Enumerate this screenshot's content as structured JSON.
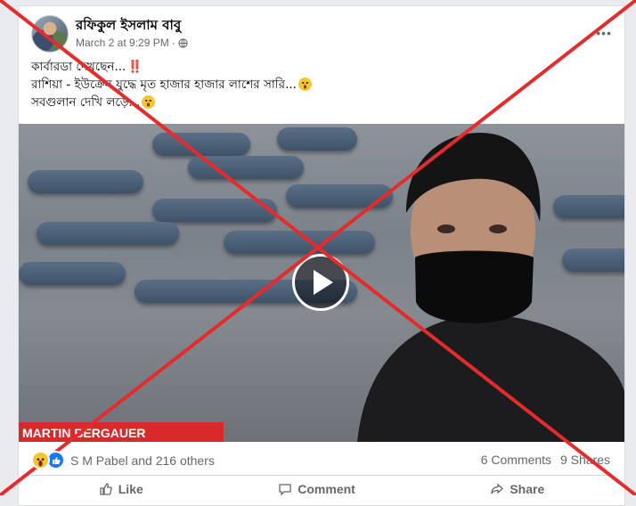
{
  "post": {
    "author": "রফিকুল ইসলাম বাবু",
    "timestamp": "March 2 at 9:29 PM",
    "separator": "·",
    "text_line1": "কার্বারডা দেখছেন...",
    "text_line1_emphasis": "‼️",
    "text_line2": "রাশিয়া - ইউক্রেন যুদ্ধে মৃত হাজার হাজার লাশের সারি...",
    "text_line3": "সবগুলান দেখি লড়ে..."
  },
  "video": {
    "lower_third_text": "MARTIN BERGAUER"
  },
  "engagement": {
    "reactors": "S M Pabel and 216 others",
    "comments": "6 Comments",
    "shares": "9 Shares"
  },
  "actions": {
    "like": "Like",
    "comment": "Comment",
    "share": "Share"
  },
  "colors": {
    "overlay_x": "#e52b2b",
    "like_blue": "#1877f2",
    "lower_third_red": "#d82a2a"
  }
}
